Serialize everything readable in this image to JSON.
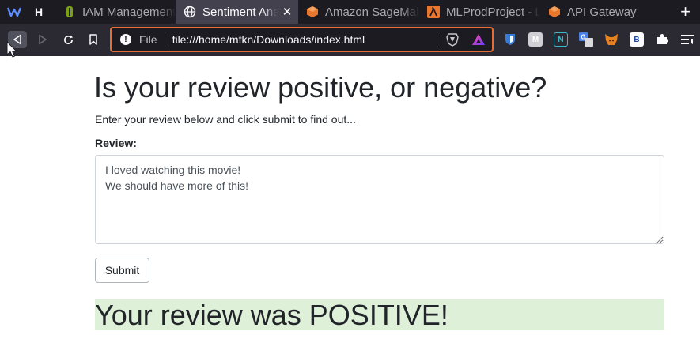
{
  "browser": {
    "pinned_tabs": [
      {
        "icon": "webflow-icon"
      },
      {
        "icon": "hackernews-icon",
        "letter": "H"
      }
    ],
    "tabs": [
      {
        "title": "IAM Management Console",
        "icon": "aws-iam-icon",
        "active": false
      },
      {
        "title": "Sentiment Analysis Web App",
        "icon": "globe-icon",
        "active": true
      },
      {
        "title": "Amazon SageMaker",
        "icon": "aws-box-icon",
        "active": false
      },
      {
        "title": "MLProdProject - Lambda",
        "icon": "aws-lambda-icon",
        "active": false
      },
      {
        "title": "API Gateway",
        "icon": "aws-box-icon",
        "active": false
      }
    ],
    "close_glyph": "✕",
    "new_tab_glyph": "+",
    "address_bar": {
      "scheme_label": "File",
      "url": "file:///home/mfkn/Downloads/index.html"
    },
    "extensions": [
      "bitwarden-icon",
      "m-icon",
      "n-icon",
      "translate-icon",
      "metamask-icon",
      "b-icon",
      "puzzle-icon",
      "reading-list-icon"
    ],
    "extension_letters": {
      "m": "M",
      "n": "N",
      "b": "B"
    },
    "accent_color": "#e66e36"
  },
  "page": {
    "heading": "Is your review positive, or negative?",
    "lead": "Enter your review below and click submit to find out...",
    "review_label": "Review:",
    "review_text": "I loved watching this movie!\nWe should have more of this!",
    "submit_label": "Submit",
    "result_text": "Your review was POSITIVE!",
    "result_color": "#dff0d8"
  }
}
